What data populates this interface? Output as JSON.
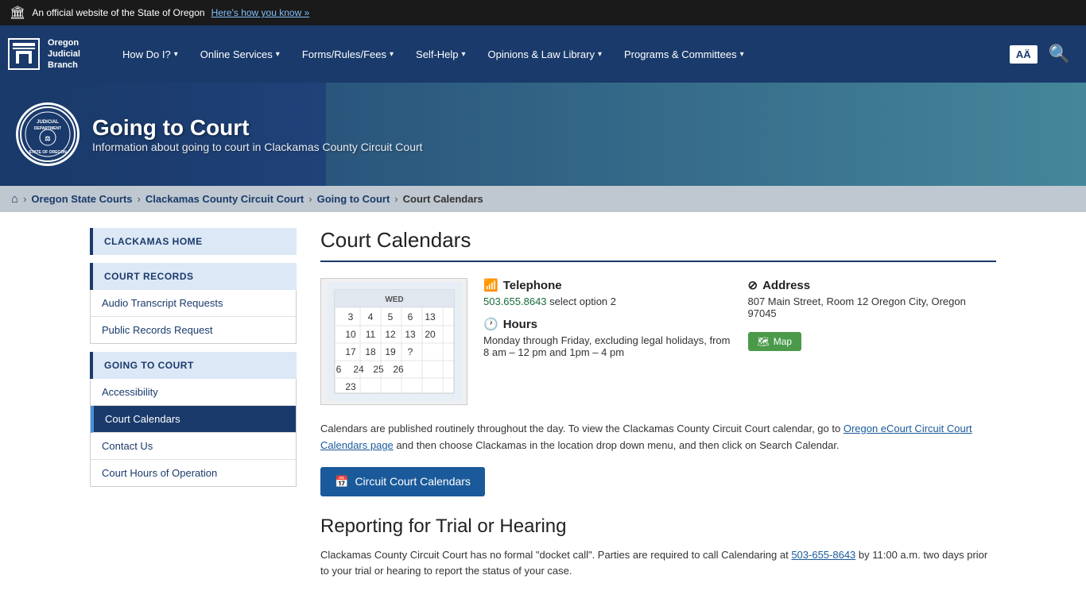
{
  "top_bar": {
    "flag": "🏛",
    "text": "An official website of the State of Oregon",
    "link_text": "Here's how you know »"
  },
  "nav": {
    "logo": {
      "line1": "Oregon",
      "line2": "Judicial",
      "line3": "Branch"
    },
    "items": [
      {
        "label": "How Do I?",
        "has_dropdown": true
      },
      {
        "label": "Online Services",
        "has_dropdown": true
      },
      {
        "label": "Forms/Rules/Fees",
        "has_dropdown": true
      },
      {
        "label": "Self-Help",
        "has_dropdown": true
      },
      {
        "label": "Opinions & Law Library",
        "has_dropdown": true
      },
      {
        "label": "Programs & Committees",
        "has_dropdown": true
      }
    ],
    "lang_btn": "AÄ",
    "search_icon": "🔍"
  },
  "hero": {
    "title": "Going to Court",
    "subtitle": "Information about going to court in Clackamas County Circuit Court"
  },
  "breadcrumb": {
    "home_icon": "⌂",
    "items": [
      {
        "label": "Oregon State Courts",
        "link": true
      },
      {
        "label": "Clackamas County Circuit Court",
        "link": true
      },
      {
        "label": "Going to Court",
        "link": true
      },
      {
        "label": "Court Calendars",
        "link": false
      }
    ]
  },
  "sidebar": {
    "clackamas_home": "CLACKAMAS HOME",
    "court_records": {
      "title": "COURT RECORDS",
      "links": [
        {
          "label": "Audio Transcript Requests"
        },
        {
          "label": "Public Records Request"
        }
      ]
    },
    "going_to_court": {
      "title": "GOING TO COURT",
      "links": [
        {
          "label": "Accessibility",
          "active": false
        },
        {
          "label": "Court Calendars",
          "active": true
        },
        {
          "label": "Contact Us",
          "active": false
        },
        {
          "label": "Court Hours of Operation",
          "active": false
        }
      ]
    }
  },
  "main": {
    "page_title": "Court Calendars",
    "telephone": {
      "label": "Telephone",
      "number": "503.655.8643",
      "detail": "select option 2"
    },
    "hours": {
      "label": "Hours",
      "detail": "Monday through Friday, excluding legal holidays, from 8 am – 12 pm and 1pm – 4 pm"
    },
    "address": {
      "label": "Address",
      "detail": "807 Main Street, Room 12 Oregon City, Oregon 97045"
    },
    "map_btn": "Map",
    "description": "Calendars are published routinely throughout the day. To view the Clackamas County Circuit Court calendar, go to Oregon eCourt Circuit Court Calendars page and then choose Clackamas in the location drop down menu, and then click on Search Calendar.",
    "description_link": "Oregon eCourt Circuit Court Calendars page",
    "circuit_btn": "Circuit Court Calendars",
    "reporting_title": "Reporting for Trial or Hearing",
    "reporting_text": "Clackamas County Circuit Court has no formal \"docket call\". Parties are required to call Calendaring at 503-655-8643 by 11:00 a.m. two days prior to your trial or hearing to report the status of your case.",
    "reporting_phone": "503-655-8643"
  }
}
